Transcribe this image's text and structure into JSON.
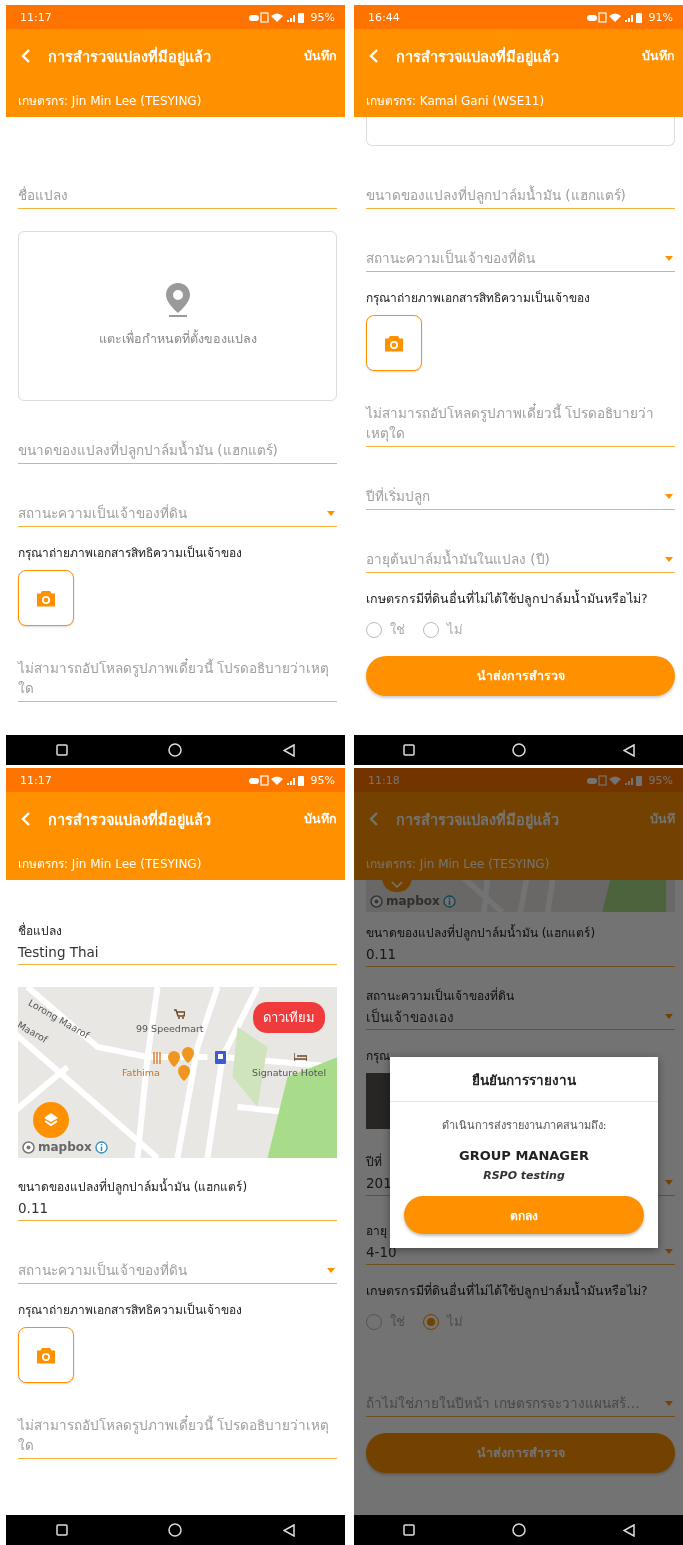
{
  "screens": [
    {
      "status_bar": {
        "time": "11:17",
        "battery": "95%"
      },
      "title": "การสำรวจแปลงที่มีอยู่แล้ว",
      "action": "บันทึก",
      "farmer": "เกษตรกร: Jin Min Lee (TESYING)",
      "dimmed": false,
      "fields": [
        {
          "kind": "text",
          "placeholder": "ชื่อแปลง"
        },
        {
          "kind": "location",
          "placeholder": "แตะเพื่อกำหนดที่ตั้งของแปลง"
        },
        {
          "kind": "text",
          "placeholder": "ขนาดของแปลงที่ปลูกปาล์มน้ำมัน (แฮกแตร์)"
        },
        {
          "kind": "select",
          "placeholder": "สถานะความเป็นเจ้าของที่ดิน"
        },
        {
          "kind": "photo",
          "prompt": "กรุณาถ่ายภาพเอกสารสิทธิความเป็นเจ้าของ",
          "taken": false
        },
        {
          "kind": "textarea",
          "placeholder": "ไม่สามารถอัปโหลดรูปภาพเดี๋ยวนี้ โปรดอธิบายว่าเหตุใด"
        }
      ]
    },
    {
      "status_bar": {
        "time": "16:44",
        "battery": "91%"
      },
      "title": "การสำรวจแปลงที่มีอยู่แล้ว",
      "action": "บันทึก",
      "farmer": "เกษตรกร: Kamal Gani (WSE11)",
      "dimmed": false,
      "fields": [
        {
          "kind": "location"
        },
        {
          "kind": "text",
          "placeholder": "ขนาดของแปลงที่ปลูกปาล์มน้ำมัน (แฮกแตร์)"
        },
        {
          "kind": "select",
          "placeholder": "สถานะความเป็นเจ้าของที่ดิน"
        },
        {
          "kind": "photo",
          "prompt": "กรุณาถ่ายภาพเอกสารสิทธิความเป็นเจ้าของ",
          "taken": false
        },
        {
          "kind": "textarea",
          "placeholder": "ไม่สามารถอัปโหลดรูปภาพเดี๋ยวนี้ โปรดอธิบายว่าเหตุใด"
        },
        {
          "kind": "select",
          "placeholder": "ปีที่เริ่มปลูก"
        },
        {
          "kind": "select",
          "placeholder": "อายุต้นปาล์มน้ำมันในแปลง (ปี)"
        },
        {
          "kind": "radio",
          "question": "เกษตรกรมีที่ดินอื่นที่ไม่ได้ใช้ปลูกปาล์มน้ำมันหรือไม่?",
          "options": [
            {
              "label": "ใช่",
              "selected": false
            },
            {
              "label": "ไม่",
              "selected": false
            }
          ]
        },
        {
          "kind": "submit",
          "label": "นำส่งการสำรวจ"
        }
      ]
    },
    {
      "status_bar": {
        "time": "11:17",
        "battery": "95%"
      },
      "title": "การสำรวจแปลงที่มีอยู่แล้ว",
      "action": "บันทึก",
      "farmer": "เกษตรกร: Jin Min Lee (TESYING)",
      "dimmed": false,
      "fields": [
        {
          "kind": "text",
          "label": "ชื่อแปลง",
          "value": "Testing Thai"
        },
        {
          "kind": "map",
          "satellite": "ดาวเทียม",
          "places": [
            "Lorong Maarof",
            "Maarof",
            "99 Speedmart",
            "Fathima",
            "Signature Hotel"
          ],
          "attribution": "mapbox"
        },
        {
          "kind": "text",
          "label": "ขนาดของแปลงที่ปลูกปาล์มน้ำมัน (แฮกแตร์)",
          "value": "0.11"
        },
        {
          "kind": "select",
          "placeholder": "สถานะความเป็นเจ้าของที่ดิน"
        },
        {
          "kind": "photo",
          "prompt": "กรุณาถ่ายภาพเอกสารสิทธิความเป็นเจ้าของ",
          "taken": false
        },
        {
          "kind": "textarea",
          "placeholder": "ไม่สามารถอัปโหลดรูปภาพเดี๋ยวนี้ โปรดอธิบายว่าเหตุใด"
        }
      ]
    },
    {
      "status_bar": {
        "time": "11:18",
        "battery": "95%"
      },
      "title": "การสำรวจแปลงที่มีอยู่แล้ว",
      "action": "บันทึ",
      "farmer": "เกษตรกร: Jin Min Lee (TESYING)",
      "dimmed": true,
      "fields": [
        {
          "kind": "map",
          "attribution": "mapbox"
        },
        {
          "kind": "text",
          "label": "ขนาดของแปลงที่ปลูกปาล์มน้ำมัน (แฮกแตร์)",
          "value": "0.11"
        },
        {
          "kind": "select",
          "label": "สถานะความเป็นเจ้าของที่ดิน",
          "value": "เป็นเจ้าของเอง"
        },
        {
          "kind": "photo",
          "prompt": "กรุณ",
          "taken": true
        },
        {
          "kind": "select",
          "label": "ปีที่",
          "value": "201"
        },
        {
          "kind": "select",
          "label": "อายุ",
          "value": "4-10"
        },
        {
          "kind": "radio",
          "question": "เกษตรกรมีที่ดินอื่นที่ไม่ได้ใช้ปลูกปาล์มน้ำมันหรือไม่?",
          "options": [
            {
              "label": "ใช่",
              "selected": false
            },
            {
              "label": "ไม่",
              "selected": true
            }
          ]
        },
        {
          "kind": "select",
          "placeholder": "ถ้าไม่ใช่ภายในปีหน้า เกษตรกรจะวางแผนสร้…"
        },
        {
          "kind": "submit",
          "label": "นำส่งการสำรวจ"
        }
      ],
      "dialog": {
        "title": "ยืนยันการรายงาน",
        "message": "ดำเนินการส่งรายงานภาคสนามถึง:",
        "recipient": "GROUP MANAGER",
        "group": "RSPO testing",
        "button": "ตกลง"
      }
    }
  ]
}
